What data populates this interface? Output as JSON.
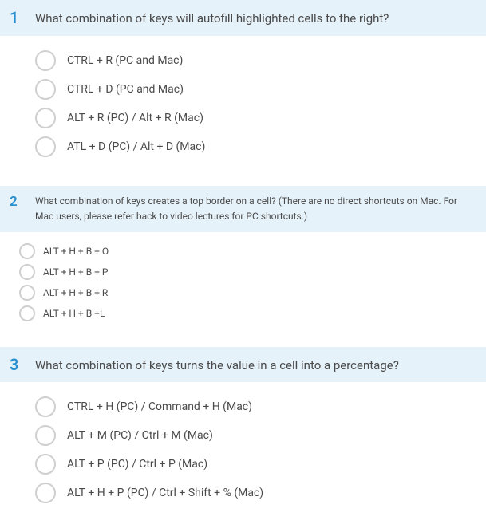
{
  "questions": [
    {
      "number": "1",
      "text": "What combination of keys will autofill highlighted cells to the right?",
      "compact": false,
      "options": [
        "CTRL + R (PC and Mac)",
        "CTRL + D (PC and Mac)",
        "ALT + R (PC) / Alt + R (Mac)",
        "ATL + D (PC) / Alt + D (Mac)"
      ]
    },
    {
      "number": "2",
      "text": "What combination of keys creates a top border on a cell? (There are no direct shortcuts on Mac. For Mac users, please refer back to video lectures for PC shortcuts.)",
      "compact": true,
      "options": [
        "ALT + H + B + O",
        "ALT + H + B + P",
        "ALT + H + B + R",
        "ALT + H + B +L"
      ]
    },
    {
      "number": "3",
      "text": "What combination of keys turns the value in a cell into a percentage?",
      "compact": false,
      "options": [
        "CTRL + H (PC) / Command + H (Mac)",
        "ALT + M (PC) / Ctrl + M (Mac)",
        "ALT + P (PC) / Ctrl + P (Mac)",
        "ALT + H + P (PC) / Ctrl + Shift + % (Mac)"
      ]
    }
  ]
}
